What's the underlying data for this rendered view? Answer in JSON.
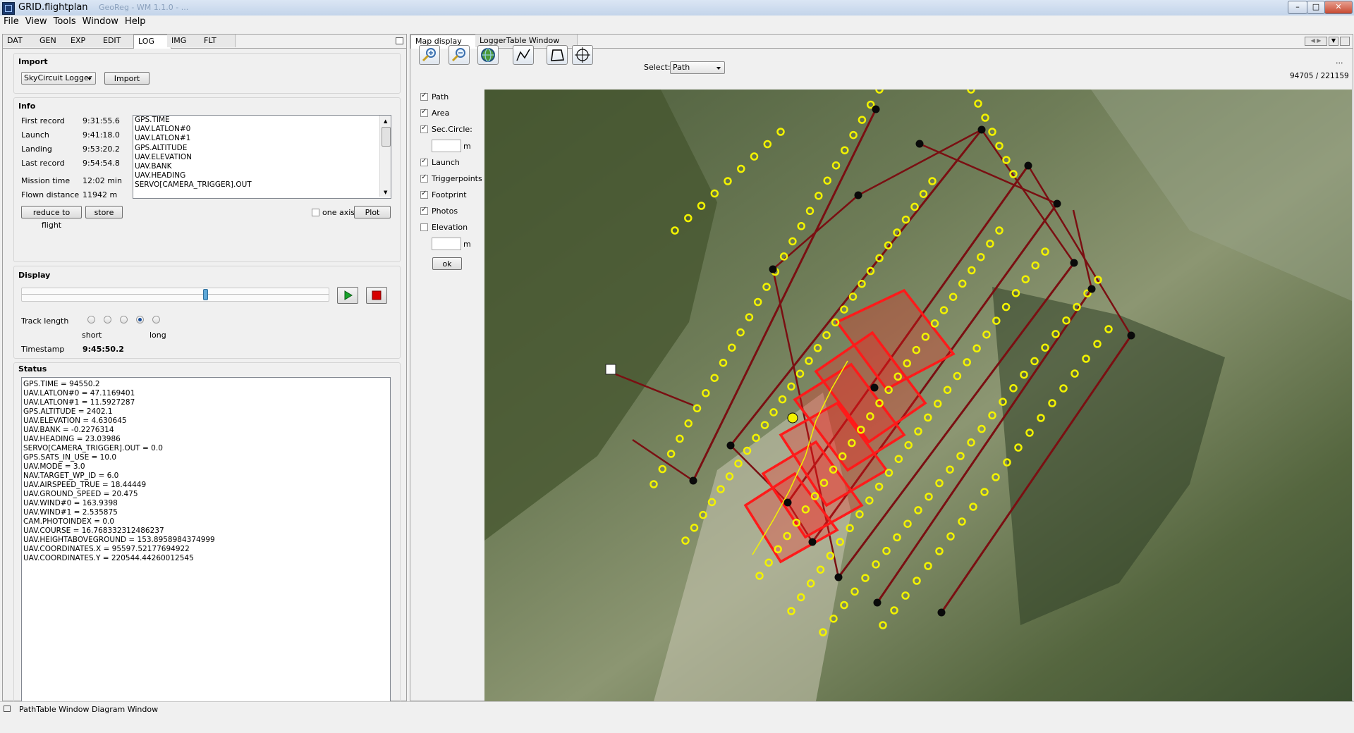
{
  "window": {
    "title": "GRID.flightplan",
    "ghost_title": "GeoReg - WM 1.1.0 - ...",
    "min": "–",
    "max": "□",
    "close": "✕"
  },
  "menu": [
    "File",
    "View",
    "Tools",
    "Window",
    "Help"
  ],
  "left_tabs": [
    "DAT",
    "GEN",
    "EXP",
    "EDIT",
    "LOG",
    "IMG",
    "FLT"
  ],
  "left_active_tab": "LOG",
  "import": {
    "title": "Import",
    "source_value": "SkyCircuit Logger",
    "import_button": "Import"
  },
  "info": {
    "title": "Info",
    "rows": [
      {
        "label": "First record",
        "value": "9:31:55.6"
      },
      {
        "label": "Launch",
        "value": "9:41:18.0"
      },
      {
        "label": "Landing",
        "value": "9:53:20.2"
      },
      {
        "label": "Last record",
        "value": "9:54:54.8"
      },
      {
        "label": "Mission time",
        "value": "12:02 min"
      },
      {
        "label": "Flown distance",
        "value": "11942 m"
      }
    ],
    "channels": [
      "GPS.TIME",
      "UAV.LATLON#0",
      "UAV.LATLON#1",
      "GPS.ALTITUDE",
      "UAV.ELEVATION",
      "UAV.BANK",
      "UAV.HEADING",
      "SERVO[CAMERA_TRIGGER].OUT"
    ],
    "reduce_button": "reduce to flight",
    "store_button": "store",
    "one_axis_label": "one axis",
    "plot_button": "Plot"
  },
  "display": {
    "title": "Display",
    "slider_position": 0.6,
    "track_length_label": "Track length",
    "track_length_selected_index": 3,
    "short_label": "short",
    "long_label": "long",
    "timestamp_label": "Timestamp",
    "timestamp_value": "9:45:50.2"
  },
  "status": {
    "title": "Status",
    "lines": [
      "GPS.TIME = 94550.2",
      "UAV.LATLON#0 = 47.1169401",
      "UAV.LATLON#1 = 11.5927287",
      "GPS.ALTITUDE = 2402.1",
      "UAV.ELEVATION = 4.630645",
      "UAV.BANK = -0.2276314",
      "UAV.HEADING = 23.03986",
      "SERVO[CAMERA_TRIGGER].OUT = 0.0",
      "GPS.SATS_IN_USE = 10.0",
      "UAV.MODE = 3.0",
      "NAV.TARGET_WP_ID = 6.0",
      "UAV.AIRSPEED_TRUE = 18.44449",
      "UAV.GROUND_SPEED = 20.475",
      "UAV.WIND#0 = 163.9398",
      "UAV.WIND#1 = 2.535875",
      "CAM.PHOTOINDEX = 0.0",
      "UAV.COURSE = 16.768332312486237",
      "UAV.HEIGHTABOVEGROUND = 153.8958984374999",
      "UAV.COORDINATES.X = 95597.52177694922",
      "UAV.COORDINATES.Y = 220544.44260012545"
    ]
  },
  "right_tabs": [
    "Map display",
    "LoggerTable Window"
  ],
  "map": {
    "select_label": "Select:",
    "select_value": "Path",
    "more": "...",
    "coords": "94705 / 221159",
    "layers": [
      {
        "label": "Path",
        "checked": true
      },
      {
        "label": "Area",
        "checked": true
      },
      {
        "label": "Sec.Circle:",
        "checked": true
      },
      {
        "label": "Launch",
        "checked": true
      },
      {
        "label": "Triggerpoints",
        "checked": true
      },
      {
        "label": "Footprint",
        "checked": true
      },
      {
        "label": "Photos",
        "checked": true
      },
      {
        "label": "Elevation",
        "checked": false
      }
    ],
    "unit": "m",
    "ok_button": "ok",
    "colors": {
      "path": "#7a0f12",
      "trigger": "#f2f200",
      "footprint": "#ff1a1a",
      "waypoint": "#0a0a0a"
    }
  },
  "bottom_tabs": [
    "PathTable Window",
    "Diagram Window"
  ]
}
